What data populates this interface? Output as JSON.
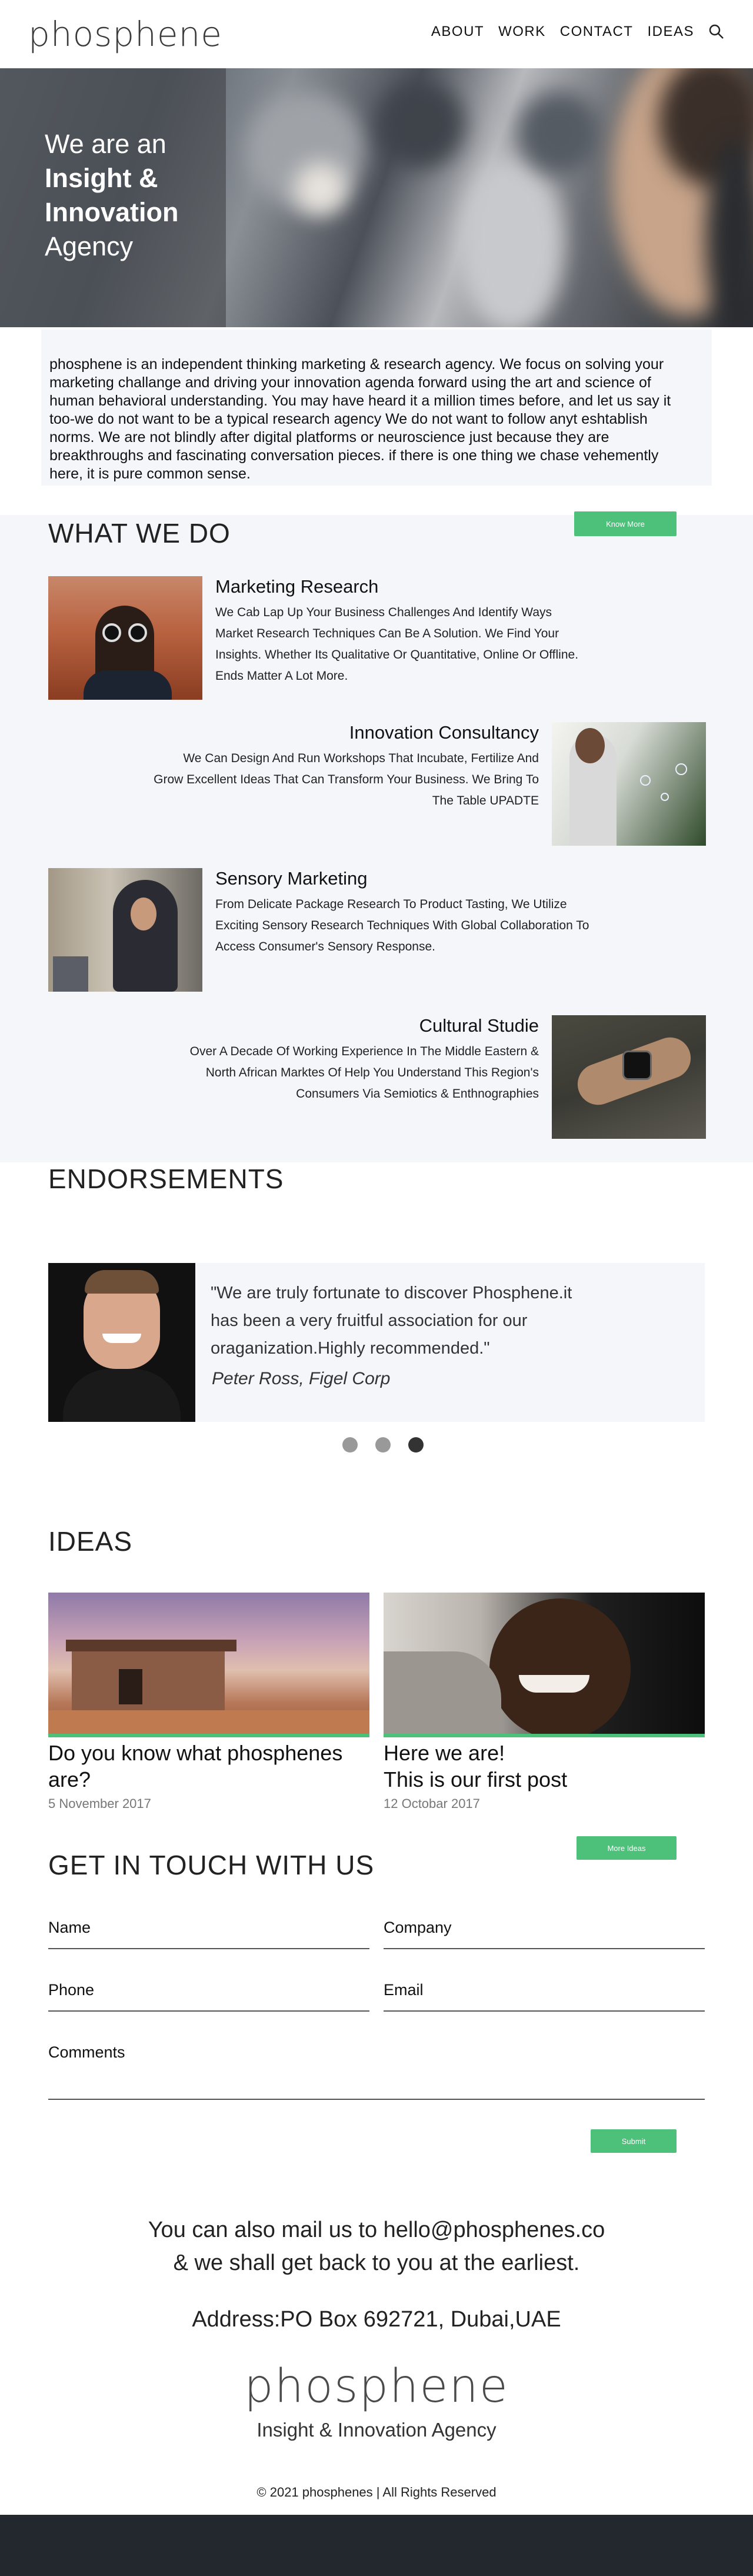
{
  "brand": {
    "logo_text": "phosphene",
    "tagline": "Insight & Innovation Agency",
    "accent": "#4dc07a"
  },
  "nav": {
    "items": [
      "ABOUT",
      "WORK",
      "CONTACT",
      "IDEAS"
    ],
    "search_icon": "search-icon"
  },
  "hero": {
    "line1": "We are an",
    "line2": "Insight &",
    "line3": "Innovation",
    "line4": "Agency"
  },
  "intro": {
    "text": "phosphene is an independent thinking marketing & research agency. We focus on solving your marketing challange and driving your innovation agenda forward using the art and science of human behavioral understanding. You may have heard it a million times before, and let us say it too-we do not want to be a typical research agency We do not want to follow anyt eshtablish norms. We are not blindly after digital platforms or neuroscience just because they are breakthroughs and fascinating conversation pieces. if there is one thing we chase vehemently here, it is pure common sense."
  },
  "what_we_do": {
    "title": "WHAT WE DO",
    "button": "Know More",
    "services": [
      {
        "title": "Marketing Research",
        "text": "We Cab Lap Up Your Business Challenges And Identify Ways Market Research Techniques Can Be A Solution. We Find Your Insights. Whether Its Qualitative Or Quantitative, Online Or Offline. Ends Matter A Lot More."
      },
      {
        "title": "Innovation Consultancy",
        "text": "We Can Design And Run Workshops That Incubate, Fertilize And Grow Excellent Ideas That Can Transform Your Business. We Bring To The Table UPADTE"
      },
      {
        "title": "Sensory Marketing",
        "text": "From Delicate Package Research To Product Tasting, We Utilize Exciting Sensory Research Techniques With Global Collaboration To Access Consumer's Sensory Response."
      },
      {
        "title": "Cultural Studie",
        "text": "Over A Decade Of Working Experience In The Middle Eastern & North African Marktes Of Help You Understand This Region's Consumers Via Semiotics & Enthnographies"
      }
    ]
  },
  "endorsements": {
    "title": "ENDORSEMENTS",
    "quote": "\"We are truly fortunate to discover Phosphene.it has been a very fruitful association for our oraganization.Highly recommended.\"",
    "author": "Peter Ross, Figel Corp",
    "slide_count": 3,
    "active_slide": 3
  },
  "ideas": {
    "title": "IDEAS",
    "button": "More Ideas",
    "posts": [
      {
        "title": "Do you know what phosphenes are?",
        "date": "5 November 2017"
      },
      {
        "title_line1": "Here we are!",
        "title_line2": "This is our first post",
        "date": "12 Octobar 2017"
      }
    ]
  },
  "contact_form": {
    "title": "GET IN TOUCH WITH US",
    "name_label": "Name",
    "company_label": "Company",
    "phone_label": "Phone",
    "email_label": "Email",
    "comments_label": "Comments",
    "submit_label": "Submit"
  },
  "contact": {
    "mail_line1": "You can also mail us to hello@phosphenes.co",
    "mail_line2": "& we shall get back to you at the earliest.",
    "address": "Address:PO Box 692721, Dubai,UAE"
  },
  "footer": {
    "logo_text": "phosphene",
    "tagline": "Insight & Innovation Agency",
    "copyright": "© 2021 phosphenes | All Rights Reserved"
  }
}
